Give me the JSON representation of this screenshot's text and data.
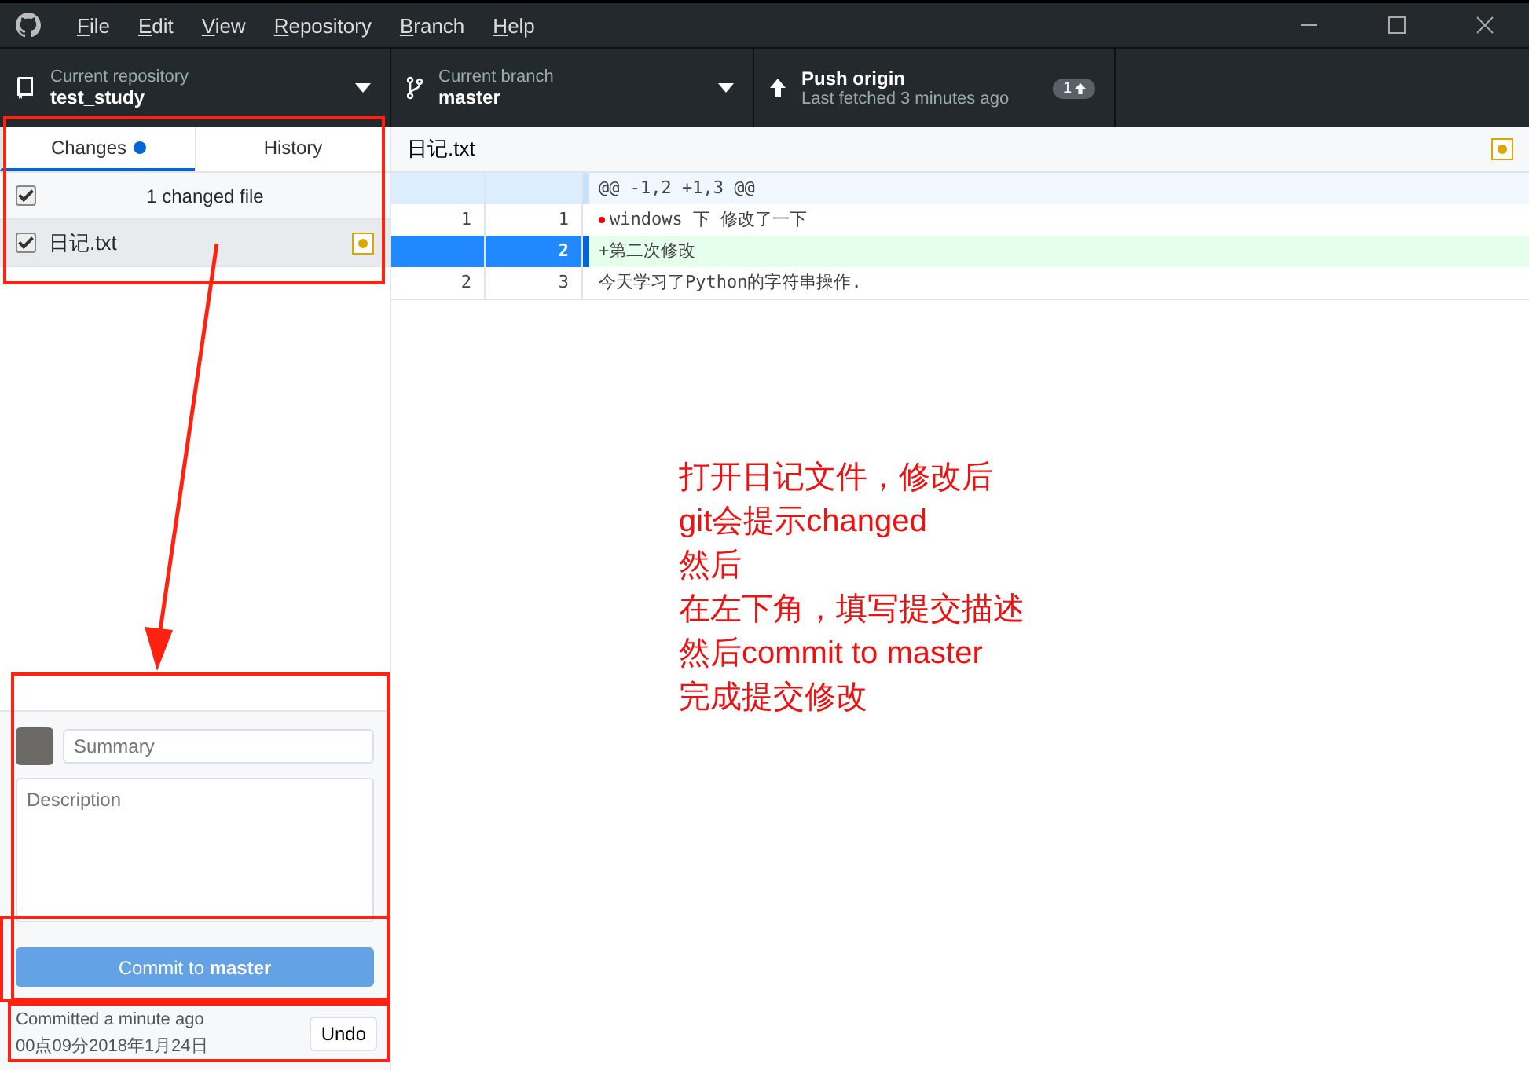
{
  "window": {
    "menu": [
      "File",
      "Edit",
      "View",
      "Repository",
      "Branch",
      "Help"
    ]
  },
  "toolbar": {
    "repository": {
      "label": "Current repository",
      "value": "test_study"
    },
    "branch": {
      "label": "Current branch",
      "value": "master"
    },
    "push": {
      "title": "Push origin",
      "subtitle": "Last fetched 3 minutes ago",
      "badge": "1"
    }
  },
  "tabs": [
    {
      "label": "Changes",
      "selected": true,
      "dot": true
    },
    {
      "label": "History",
      "selected": false,
      "dot": false
    }
  ],
  "changes": {
    "header": {
      "label": "1 changed file",
      "checked": true
    },
    "files": [
      {
        "name": "日记.txt",
        "checked": true,
        "selected": true
      }
    ]
  },
  "commit": {
    "summary_placeholder": "Summary",
    "description_placeholder": "Description",
    "button": {
      "text": "Commit to **master**",
      "disabled": true
    }
  },
  "last_commit": {
    "label": "Committed a minute ago",
    "time": "00点09分2018年1月24日",
    "undo": "Undo"
  },
  "diff": {
    "file": "日记.txt",
    "lines": [
      {
        "kind": "hunk",
        "text": "@@ -1,2 +1,3 @@",
        "selected": false,
        "marked": false
      },
      {
        "kind": "context",
        "old": "1",
        "new": "1",
        "text": "windows 下 修改了一下",
        "selected": false,
        "marked": true
      },
      {
        "kind": "added",
        "new": "2",
        "text": "+第二次修改",
        "selected": true,
        "marked": false
      },
      {
        "kind": "context",
        "old": "2",
        "new": "3",
        "text": "今天学习了Python的字符串操作.",
        "selected": false,
        "marked": false
      }
    ]
  },
  "annotation": {
    "lines": [
      "打开日记文件，修改后",
      "git会提示changed",
      "然后",
      "在左下角，填写提交描述",
      "然后commit to master",
      "完成提交修改"
    ]
  }
}
